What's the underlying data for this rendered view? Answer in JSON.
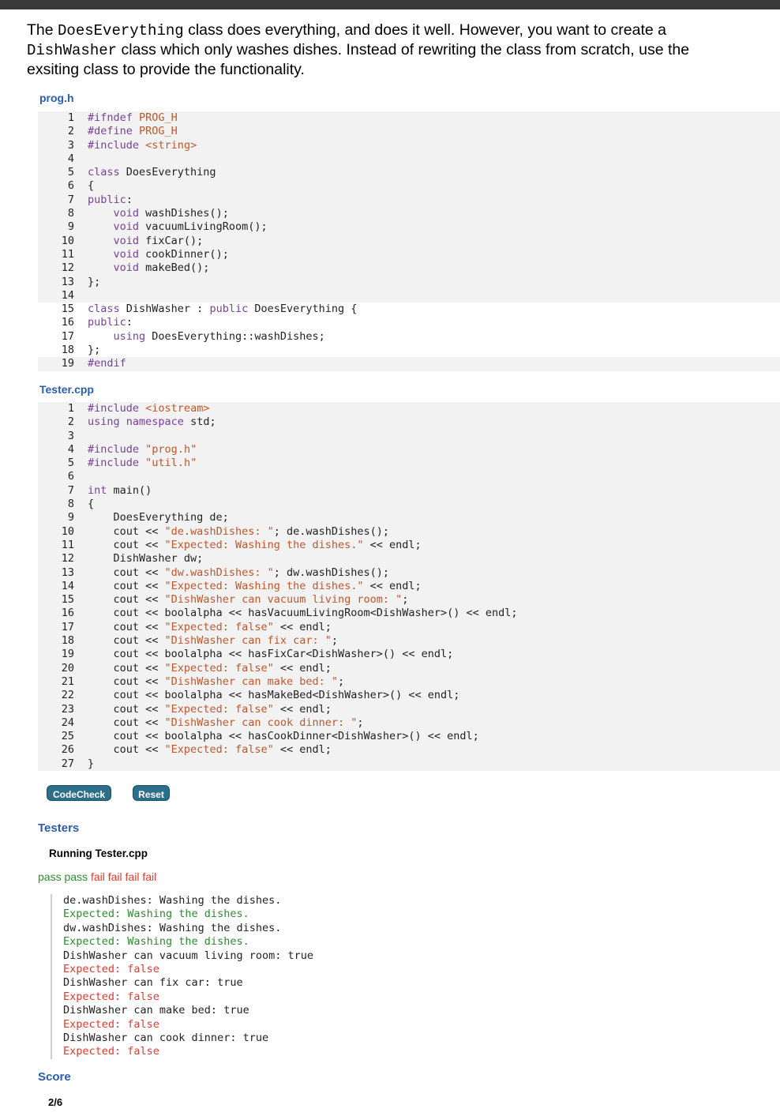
{
  "prompt": {
    "text1": "The ",
    "class_name": "DoesEverything",
    "text2": " class does everything, and does it well. However, you want to create a ",
    "new_class": "DishWasher",
    "text3": " class which only washes dishes. Instead of rewriting the class from scratch, use the exsiting class to provide the functionality."
  },
  "files": [
    {
      "label": "prog.h",
      "lines": [
        {
          "n": "1",
          "code": "#ifndef PROG_H",
          "editable": false
        },
        {
          "n": "2",
          "code": "#define PROG_H",
          "editable": false
        },
        {
          "n": "3",
          "code": "#include <string>",
          "editable": false
        },
        {
          "n": "4",
          "code": "",
          "editable": false
        },
        {
          "n": "5",
          "code": "class DoesEverything",
          "editable": false
        },
        {
          "n": "6",
          "code": "{",
          "editable": false
        },
        {
          "n": "7",
          "code": "public:",
          "editable": false
        },
        {
          "n": "8",
          "code": "    void washDishes();",
          "editable": false
        },
        {
          "n": "9",
          "code": "    void vacuumLivingRoom();",
          "editable": false
        },
        {
          "n": "10",
          "code": "    void fixCar();",
          "editable": false
        },
        {
          "n": "11",
          "code": "    void cookDinner();",
          "editable": false
        },
        {
          "n": "12",
          "code": "    void makeBed();",
          "editable": false
        },
        {
          "n": "13",
          "code": "};",
          "editable": false
        },
        {
          "n": "14",
          "code": "",
          "editable": false
        },
        {
          "n": "15",
          "code": "class DishWasher : public DoesEverything {",
          "editable": true
        },
        {
          "n": "16",
          "code": "public:",
          "editable": true
        },
        {
          "n": "17",
          "code": "    using DoesEverything::washDishes;",
          "editable": true
        },
        {
          "n": "18",
          "code": "};",
          "editable": true
        },
        {
          "n": "19",
          "code": "#endif",
          "editable": false
        }
      ]
    },
    {
      "label": "Tester.cpp",
      "lines": [
        {
          "n": "1",
          "code": "#include <iostream>",
          "editable": false
        },
        {
          "n": "2",
          "code": "using namespace std;",
          "editable": false
        },
        {
          "n": "3",
          "code": "",
          "editable": false
        },
        {
          "n": "4",
          "code": "#include \"prog.h\"",
          "editable": false
        },
        {
          "n": "5",
          "code": "#include \"util.h\"",
          "editable": false
        },
        {
          "n": "6",
          "code": "",
          "editable": false
        },
        {
          "n": "7",
          "code": "int main()",
          "editable": false
        },
        {
          "n": "8",
          "code": "{",
          "editable": false
        },
        {
          "n": "9",
          "code": "    DoesEverything de;",
          "editable": false
        },
        {
          "n": "10",
          "code": "    cout << \"de.washDishes: \"; de.washDishes();",
          "editable": false
        },
        {
          "n": "11",
          "code": "    cout << \"Expected: Washing the dishes.\" << endl;",
          "editable": false
        },
        {
          "n": "12",
          "code": "    DishWasher dw;",
          "editable": false
        },
        {
          "n": "13",
          "code": "    cout << \"dw.washDishes: \"; dw.washDishes();",
          "editable": false
        },
        {
          "n": "14",
          "code": "    cout << \"Expected: Washing the dishes.\" << endl;",
          "editable": false
        },
        {
          "n": "15",
          "code": "    cout << \"DishWasher can vacuum living room: \";",
          "editable": false
        },
        {
          "n": "16",
          "code": "    cout << boolalpha << hasVacuumLivingRoom<DishWasher>() << endl;",
          "editable": false
        },
        {
          "n": "17",
          "code": "    cout << \"Expected: false\" << endl;",
          "editable": false
        },
        {
          "n": "18",
          "code": "    cout << \"DishWasher can fix car: \";",
          "editable": false
        },
        {
          "n": "19",
          "code": "    cout << boolalpha << hasFixCar<DishWasher>() << endl;",
          "editable": false
        },
        {
          "n": "20",
          "code": "    cout << \"Expected: false\" << endl;",
          "editable": false
        },
        {
          "n": "21",
          "code": "    cout << \"DishWasher can make bed: \";",
          "editable": false
        },
        {
          "n": "22",
          "code": "    cout << boolalpha << hasMakeBed<DishWasher>() << endl;",
          "editable": false
        },
        {
          "n": "23",
          "code": "    cout << \"Expected: false\" << endl;",
          "editable": false
        },
        {
          "n": "24",
          "code": "    cout << \"DishWasher can cook dinner: \";",
          "editable": false
        },
        {
          "n": "25",
          "code": "    cout << boolalpha << hasCookDinner<DishWasher>() << endl;",
          "editable": false
        },
        {
          "n": "26",
          "code": "    cout << \"Expected: false\" << endl;",
          "editable": false
        },
        {
          "n": "27",
          "code": "}",
          "editable": false
        }
      ]
    }
  ],
  "buttons": {
    "codecheck": "CodeCheck",
    "reset": "Reset"
  },
  "testers": {
    "title": "Testers",
    "running": "Running Tester.cpp",
    "results": [
      "pass",
      "pass",
      "fail",
      "fail",
      "fail",
      "fail"
    ],
    "output": [
      {
        "text": "de.washDishes: Washing the dishes.",
        "kind": "plain"
      },
      {
        "text": "Expected: Washing the dishes.",
        "kind": "good"
      },
      {
        "text": "dw.washDishes: Washing the dishes.",
        "kind": "plain"
      },
      {
        "text": "Expected: Washing the dishes.",
        "kind": "good"
      },
      {
        "text": "DishWasher can vacuum living room: true",
        "kind": "plain"
      },
      {
        "text": "Expected: false",
        "kind": "bad"
      },
      {
        "text": "DishWasher can fix car: true",
        "kind": "plain"
      },
      {
        "text": "Expected: false",
        "kind": "bad"
      },
      {
        "text": "DishWasher can make bed: true",
        "kind": "plain"
      },
      {
        "text": "Expected: false",
        "kind": "bad"
      },
      {
        "text": "DishWasher can cook dinner: true",
        "kind": "plain"
      },
      {
        "text": "Expected: false",
        "kind": "bad"
      }
    ]
  },
  "score": {
    "title": "Score",
    "value": "2/6"
  },
  "colors": {
    "pass": "#2e8b2e",
    "fail": "#e03a2f",
    "label": "#2a5db0",
    "button": "#2b6f8a"
  }
}
